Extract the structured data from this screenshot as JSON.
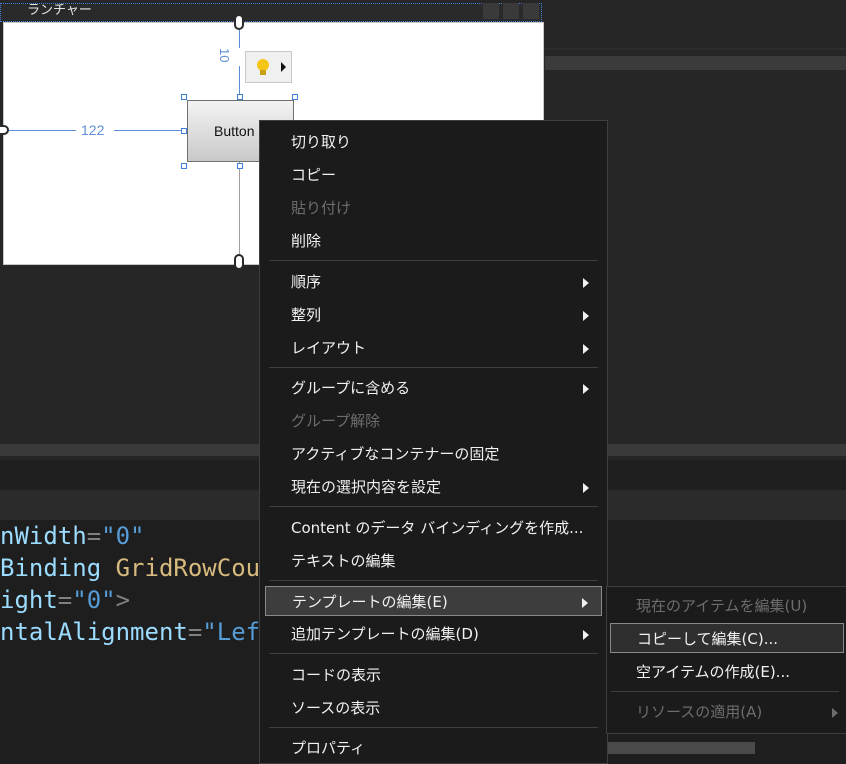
{
  "designer": {
    "window_title": "ランチャー",
    "button_label": "Button",
    "margin_left": "122",
    "margin_top": "10"
  },
  "editor": {
    "lines": [
      {
        "name": "nWidth",
        "eq": "=",
        "value": "\"0\"",
        "tail": ""
      },
      {
        "name": "Binding",
        "eq": " ",
        "value": "GridRowCou",
        "tail": ""
      },
      {
        "name": "ight",
        "eq": "=",
        "value": "\"0\"",
        "tail": ">"
      },
      {
        "name": "ntalAlignment",
        "eq": "=",
        "value": "\"Lef",
        "tail": ""
      }
    ]
  },
  "context_menu": {
    "items": [
      {
        "label": "切り取り",
        "enabled": true,
        "submenu": false
      },
      {
        "label": "コピー",
        "enabled": true,
        "submenu": false
      },
      {
        "label": "貼り付け",
        "enabled": false,
        "submenu": false
      },
      {
        "label": "削除",
        "enabled": true,
        "submenu": false
      },
      {
        "label": "順序",
        "enabled": true,
        "submenu": true
      },
      {
        "label": "整列",
        "enabled": true,
        "submenu": true
      },
      {
        "label": "レイアウト",
        "enabled": true,
        "submenu": true
      },
      {
        "label": "グループに含める",
        "enabled": true,
        "submenu": true
      },
      {
        "label": "グループ解除",
        "enabled": false,
        "submenu": false
      },
      {
        "label": "アクティブなコンテナーの固定",
        "enabled": true,
        "submenu": false
      },
      {
        "label": "現在の選択内容を設定",
        "enabled": true,
        "submenu": true
      },
      {
        "label": "Content のデータ バインディングを作成...",
        "enabled": true,
        "submenu": false
      },
      {
        "label": "テキストの編集",
        "enabled": true,
        "submenu": false
      },
      {
        "label": "テンプレートの編集(E)",
        "enabled": true,
        "submenu": true
      },
      {
        "label": "追加テンプレートの編集(D)",
        "enabled": true,
        "submenu": true
      },
      {
        "label": "コードの表示",
        "enabled": true,
        "submenu": false
      },
      {
        "label": "ソースの表示",
        "enabled": true,
        "submenu": false
      },
      {
        "label": "プロパティ",
        "enabled": true,
        "submenu": false
      }
    ]
  },
  "submenu": {
    "items": [
      {
        "label": "現在のアイテムを編集(U)",
        "enabled": false
      },
      {
        "label": "コピーして編集(C)...",
        "enabled": true
      },
      {
        "label": "空アイテムの作成(E)...",
        "enabled": true
      },
      {
        "label": "リソースの適用(A)",
        "enabled": false
      }
    ]
  },
  "colors": {
    "menu_bg": "#1b1b1b",
    "highlight": "#3d3d3d",
    "disabled_text": "#6d6d6d",
    "adorner_blue": "#5d8fd6"
  }
}
